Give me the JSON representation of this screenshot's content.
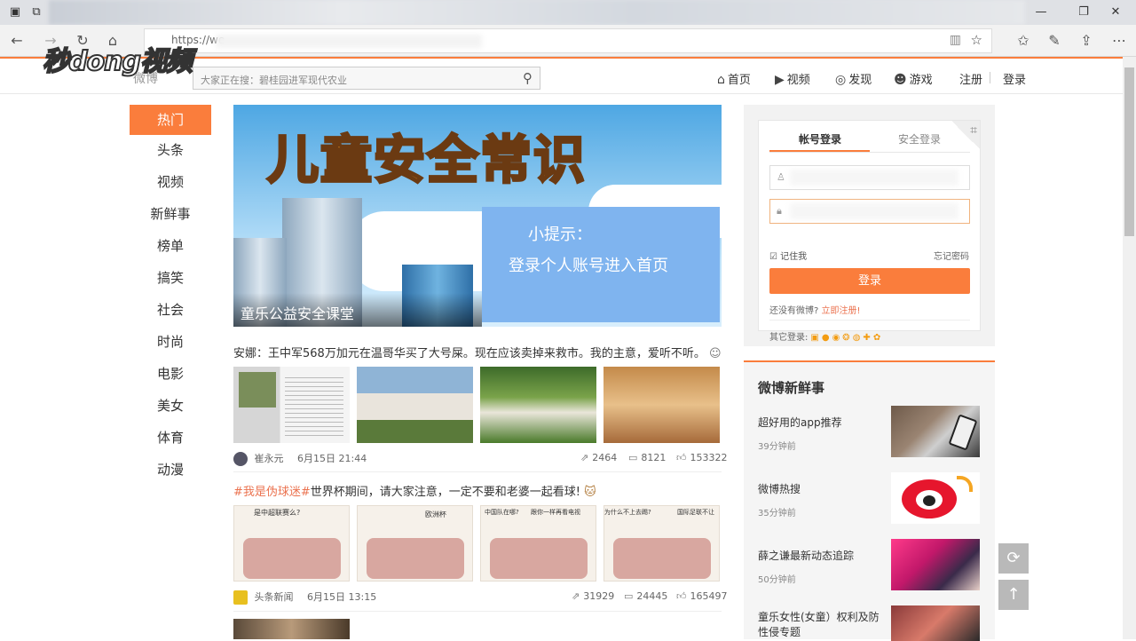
{
  "browser": {
    "url": "https://we",
    "back_icon": "←",
    "forward_icon": "→",
    "refresh_icon": "↻",
    "home_icon": "⌂"
  },
  "watermark": "秒dong视频",
  "header": {
    "logo": "微博",
    "search_placeholder": "大家正在搜：碧桂园进军现代农业",
    "nav": [
      {
        "icon": "⌂",
        "label": "首页"
      },
      {
        "icon": "▶",
        "label": "视频"
      },
      {
        "icon": "◎",
        "label": "发现"
      },
      {
        "icon": "☻",
        "label": "游戏"
      }
    ],
    "register": "注册",
    "login": "登录"
  },
  "sidebar": {
    "items": [
      "热门",
      "头条",
      "视频",
      "新鲜事",
      "榜单",
      "搞笑",
      "社会",
      "时尚",
      "电影",
      "美女",
      "体育",
      "动漫"
    ]
  },
  "banner": {
    "title": "儿童安全常识",
    "tip_title": "小提示：",
    "tip_text": "登录个人账号进入首页",
    "caption": "童乐公益安全课堂"
  },
  "feed": [
    {
      "text": "安娜：王中军568万加元在温哥华买了大号屎。现在应该卖掉来救市。我的主意，爱听不听。",
      "author": "崔永元",
      "time": "6月15日 21:44",
      "reposts": "2464",
      "comments": "8121",
      "likes": "153322"
    },
    {
      "tag": "#我是伪球迷#",
      "text": "世界杯期间，请大家注意，一定不要和老婆一起看球!",
      "author": "头条新闻",
      "time": "6月15日 13:15",
      "reposts": "31929",
      "comments": "24445",
      "likes": "165497",
      "comic_bubbles": [
        "是中超联赛么?",
        "欧洲杯",
        "中国队在哪?",
        "跟你一样再看电视",
        "为什么不上去踢?",
        "国际足联不让"
      ]
    }
  ],
  "login": {
    "tab_account": "帐号登录",
    "tab_secure": "安全登录",
    "remember": "记住我",
    "forgot": "忘记密码",
    "button": "登录",
    "no_account": "还没有微博?",
    "register_now": "立即注册!",
    "other_login": "其它登录:"
  },
  "news": {
    "title": "微博新鲜事",
    "items": [
      {
        "title": "超好用的app推荐",
        "time": "39分钟前"
      },
      {
        "title": "微博热搜",
        "time": "35分钟前"
      },
      {
        "title": "薛之谦最新动态追踪",
        "time": "50分钟前"
      },
      {
        "title": "童乐女性(女童）权利及防性侵专题",
        "time": ""
      }
    ]
  },
  "float_buttons": {
    "refresh": "⟳",
    "top": "↑"
  },
  "colors": {
    "accent": "#fa7d3c",
    "link": "#eb7350"
  }
}
